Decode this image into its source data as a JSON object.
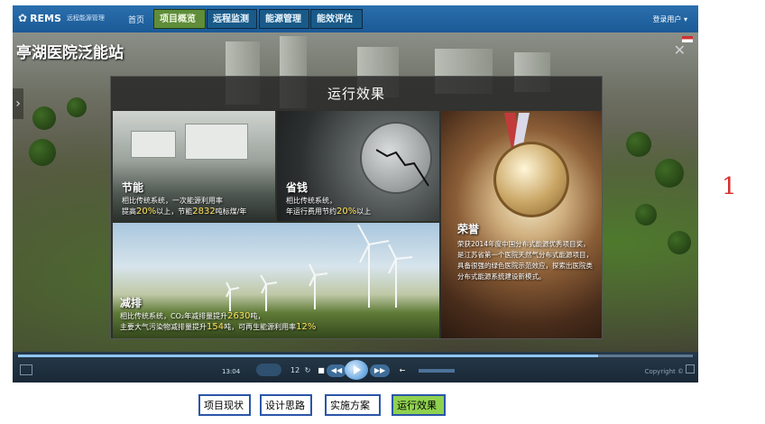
{
  "app": {
    "brand": "REMS",
    "brand_sub": "远程能源管理",
    "nav_home": "首页",
    "tabs": [
      {
        "label": "项目概览",
        "active": true
      },
      {
        "label": "远程监测",
        "active": false
      },
      {
        "label": "能源管理",
        "active": false
      },
      {
        "label": "能效评估",
        "active": false
      }
    ],
    "login": "登录用户 ▾"
  },
  "scene": {
    "site_title": "亭湖医院泛能站"
  },
  "modal": {
    "title": "运行效果",
    "cards": {
      "energy": {
        "title": "节能",
        "line1": "相比传统系统，一次能源利用率",
        "line2_a": "提高",
        "line2_b": "20%",
        "line2_c": "以上，节能",
        "line2_d": "2832",
        "line2_e": "吨标煤/年"
      },
      "money": {
        "title": "省钱",
        "line1": "相比传统系统，",
        "line2_a": "年运行费用节约",
        "line2_b": "20%",
        "line2_c": "以上"
      },
      "honor": {
        "title": "荣誉",
        "text": "荣获2014年度中国分布式能源优秀项目奖，是江苏省第一个医院天然气分布式能源项目，具备很强的绿色医院示范效应，探索出医院类分布式能源系统建设新模式。"
      },
      "reduce": {
        "title": "减排",
        "line1_a": "相比传统系统，CO₂年减排量提升",
        "line1_b": "2630",
        "line1_c": "吨，",
        "line2_a": "主要大气污染物减排量提升",
        "line2_b": "154",
        "line2_c": "吨，可再生能源利用率",
        "line2_d": "12%"
      }
    }
  },
  "player": {
    "time": "13:04",
    "page": "12",
    "progress": 0.86,
    "copyright": "Copyright ©"
  },
  "side_number": "1",
  "bottom_tabs": [
    {
      "label": "项目现状",
      "active": false
    },
    {
      "label": "设计思路",
      "active": false
    },
    {
      "label": "实施方案",
      "active": false
    },
    {
      "label": "运行效果",
      "active": true
    }
  ],
  "colors": {
    "accent_green": "#8fd14f",
    "nav_blue": "#1b5a95",
    "highlight_yellow": "#ffe35c",
    "side_red": "#d83030"
  }
}
